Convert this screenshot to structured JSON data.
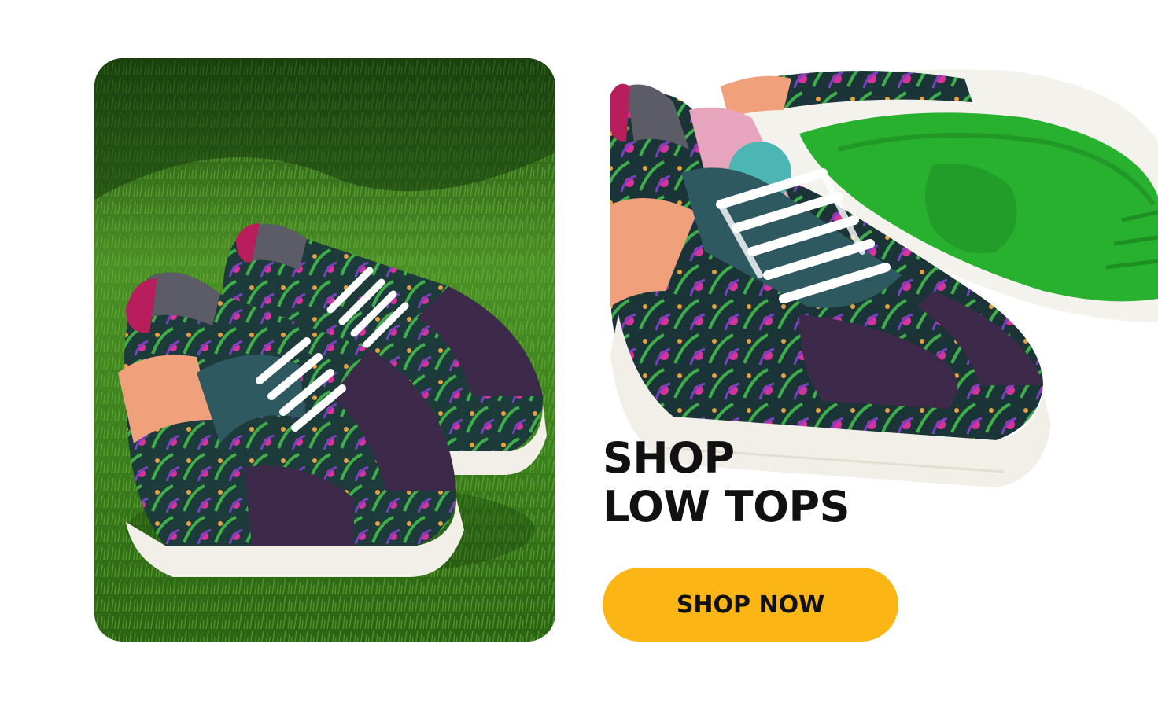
{
  "promo": {
    "headline_line1": "SHOP",
    "headline_line2": "LOW TOPS",
    "cta_label": "SHOP NOW"
  },
  "colors": {
    "cta_background": "#fbb616",
    "headline_text": "#111111",
    "page_background": "#ffffff"
  },
  "images": {
    "lifestyle_photo": "sneakers-on-grass-photo",
    "product_photo": "low-top-sneaker-with-green-sole-photo"
  }
}
